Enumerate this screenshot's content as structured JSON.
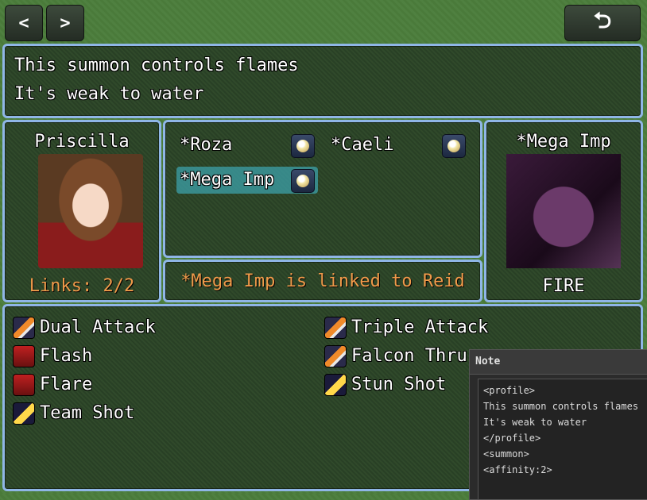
{
  "nav": {
    "prev": "<",
    "next": ">",
    "back": "⮌"
  },
  "help": {
    "line1": "This summon controls flames",
    "line2": "It's weak to water"
  },
  "actor": {
    "name": "Priscilla",
    "links": "Links: 2/2"
  },
  "summons": [
    {
      "name": "*Roza"
    },
    {
      "name": "*Caeli"
    },
    {
      "name": "*Mega Imp"
    }
  ],
  "status": "*Mega Imp is linked to Reid",
  "info": {
    "name": "*Mega Imp",
    "element": "FIRE"
  },
  "skills": [
    {
      "label": "Dual Attack",
      "icon": "sword-icon"
    },
    {
      "label": "Triple Attack",
      "icon": "sword-icon"
    },
    {
      "label": "Flash",
      "icon": "flash-icon"
    },
    {
      "label": "Falcon Thru",
      "icon": "sword-icon"
    },
    {
      "label": "Flare",
      "icon": "flash-icon"
    },
    {
      "label": "Stun Shot",
      "icon": "shot-icon"
    },
    {
      "label": "Team Shot",
      "icon": "shot-icon"
    }
  ],
  "note": {
    "title": "Note",
    "lines": [
      "<profile>",
      "This summon controls flames",
      "It's weak to water",
      "</profile>",
      "<summon>",
      "<affinity:2>"
    ]
  }
}
